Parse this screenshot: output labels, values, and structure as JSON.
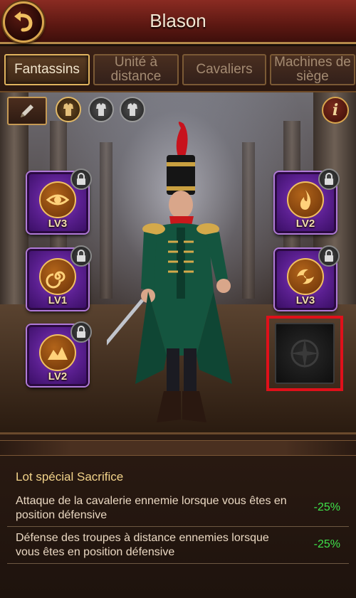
{
  "header": {
    "title": "Blason"
  },
  "tabs": [
    {
      "label": "Fantassins",
      "active": true
    },
    {
      "label": "Unité à distance",
      "active": false
    },
    {
      "label": "Cavaliers",
      "active": false
    },
    {
      "label": "Machines de siège",
      "active": false
    }
  ],
  "toolbar": {
    "edit_icon": "pencil-icon",
    "armor_sets": [
      "armor-set-1-icon",
      "armor-set-2-icon",
      "armor-set-3-icon"
    ],
    "info_glyph": "i"
  },
  "badges": {
    "left": [
      {
        "level": "LV3",
        "emblem": "eye-icon",
        "locked": true
      },
      {
        "level": "LV1",
        "emblem": "spiral-icon",
        "locked": true
      },
      {
        "level": "LV2",
        "emblem": "mountain-icon",
        "locked": true
      }
    ],
    "right": [
      {
        "level": "LV2",
        "emblem": "flame-icon",
        "locked": true
      },
      {
        "level": "LV3",
        "emblem": "swirl-icon",
        "locked": true
      }
    ],
    "empty_slot": {
      "icon": "compass-icon",
      "highlighted": true
    }
  },
  "bonus": {
    "title": "Lot spécial Sacrifice",
    "rows": [
      {
        "text": "Attaque de la cavalerie ennemie lorsque vous êtes en position défensive",
        "value": "-25%"
      },
      {
        "text": "Défense des troupes à distance ennemies lorsque vous êtes en position défensive",
        "value": "-25%"
      }
    ]
  },
  "colors": {
    "accent_gold": "#d9a64e",
    "value_green": "#3ee24a",
    "highlight_red": "#e0101a",
    "badge_purple": "#6a2aa0"
  }
}
